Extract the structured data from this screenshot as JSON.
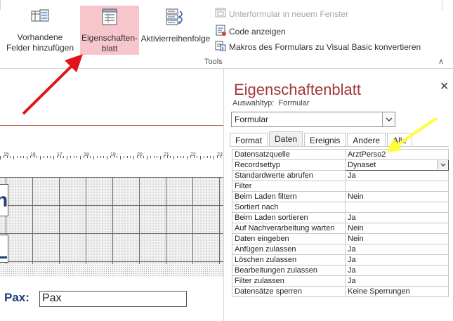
{
  "ribbon": {
    "existing_fields": [
      "Vorhandene",
      "Felder hinzufügen"
    ],
    "property_sheet": [
      "Eigenschaften-",
      "blatt"
    ],
    "tab_order": "Aktivierreihenfolge",
    "subform_new_window": "Unterformular in neuem Fenster",
    "view_code": "Code anzeigen",
    "convert_macros": "Makros des Formulars zu Visual Basic konvertieren",
    "group_label": "Tools",
    "collapse_glyph": "∧"
  },
  "designer": {
    "ruler_numbers": [
      "15",
      "16",
      "17",
      "18",
      "19",
      "20",
      "21",
      "22",
      "23"
    ],
    "partial_letter": "n",
    "pax_label": "Pax:",
    "pax_value": "Pax"
  },
  "panel": {
    "title": "Eigenschaftenblatt",
    "close": "✕",
    "selection_type_label": "Auswahltyp:",
    "selection_type_value": "Formular",
    "selected_object": "Formular",
    "tabs": [
      "Format",
      "Daten",
      "Ereignis",
      "Andere",
      "Alle"
    ],
    "active_tab": "Daten",
    "properties": [
      {
        "name": "Datensatzquelle",
        "value": "ArztPerso2"
      },
      {
        "name": "Recordsettyp",
        "value": "Dynaset"
      },
      {
        "name": "Standardwerte abrufen",
        "value": "Ja"
      },
      {
        "name": "Filter",
        "value": ""
      },
      {
        "name": "Beim Laden filtern",
        "value": "Nein"
      },
      {
        "name": "Sortiert nach",
        "value": ""
      },
      {
        "name": "Beim Laden sortieren",
        "value": "Ja"
      },
      {
        "name": "Auf Nachverarbeitung warten",
        "value": "Nein"
      },
      {
        "name": "Daten eingeben",
        "value": "Nein"
      },
      {
        "name": "Anfügen zulassen",
        "value": "Ja"
      },
      {
        "name": "Löschen zulassen",
        "value": "Ja"
      },
      {
        "name": "Bearbeitungen zulassen",
        "value": "Ja"
      },
      {
        "name": "Filter zulassen",
        "value": "Ja"
      },
      {
        "name": "Datensätze sperren",
        "value": "Keine Sperrungen"
      }
    ]
  },
  "annotations": {
    "red_arrow_color": "#e0141b",
    "yellow_arrow_color": "#ffff33"
  }
}
